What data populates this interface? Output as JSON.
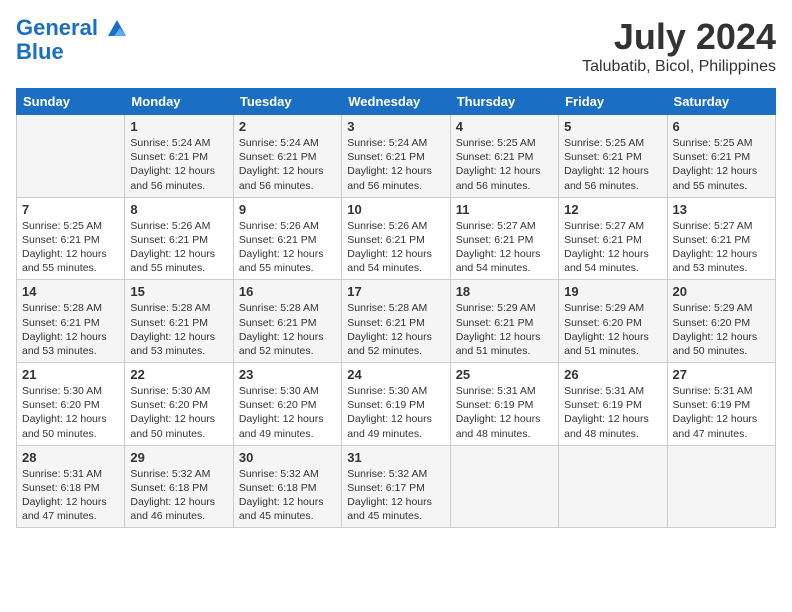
{
  "header": {
    "logo_line1": "General",
    "logo_line2": "Blue",
    "month": "July 2024",
    "location": "Talubatib, Bicol, Philippines"
  },
  "weekdays": [
    "Sunday",
    "Monday",
    "Tuesday",
    "Wednesday",
    "Thursday",
    "Friday",
    "Saturday"
  ],
  "weeks": [
    [
      {
        "day": "",
        "sunrise": "",
        "sunset": "",
        "daylight": ""
      },
      {
        "day": "1",
        "sunrise": "Sunrise: 5:24 AM",
        "sunset": "Sunset: 6:21 PM",
        "daylight": "Daylight: 12 hours and 56 minutes."
      },
      {
        "day": "2",
        "sunrise": "Sunrise: 5:24 AM",
        "sunset": "Sunset: 6:21 PM",
        "daylight": "Daylight: 12 hours and 56 minutes."
      },
      {
        "day": "3",
        "sunrise": "Sunrise: 5:24 AM",
        "sunset": "Sunset: 6:21 PM",
        "daylight": "Daylight: 12 hours and 56 minutes."
      },
      {
        "day": "4",
        "sunrise": "Sunrise: 5:25 AM",
        "sunset": "Sunset: 6:21 PM",
        "daylight": "Daylight: 12 hours and 56 minutes."
      },
      {
        "day": "5",
        "sunrise": "Sunrise: 5:25 AM",
        "sunset": "Sunset: 6:21 PM",
        "daylight": "Daylight: 12 hours and 56 minutes."
      },
      {
        "day": "6",
        "sunrise": "Sunrise: 5:25 AM",
        "sunset": "Sunset: 6:21 PM",
        "daylight": "Daylight: 12 hours and 55 minutes."
      }
    ],
    [
      {
        "day": "7",
        "sunrise": "Sunrise: 5:25 AM",
        "sunset": "Sunset: 6:21 PM",
        "daylight": "Daylight: 12 hours and 55 minutes."
      },
      {
        "day": "8",
        "sunrise": "Sunrise: 5:26 AM",
        "sunset": "Sunset: 6:21 PM",
        "daylight": "Daylight: 12 hours and 55 minutes."
      },
      {
        "day": "9",
        "sunrise": "Sunrise: 5:26 AM",
        "sunset": "Sunset: 6:21 PM",
        "daylight": "Daylight: 12 hours and 55 minutes."
      },
      {
        "day": "10",
        "sunrise": "Sunrise: 5:26 AM",
        "sunset": "Sunset: 6:21 PM",
        "daylight": "Daylight: 12 hours and 54 minutes."
      },
      {
        "day": "11",
        "sunrise": "Sunrise: 5:27 AM",
        "sunset": "Sunset: 6:21 PM",
        "daylight": "Daylight: 12 hours and 54 minutes."
      },
      {
        "day": "12",
        "sunrise": "Sunrise: 5:27 AM",
        "sunset": "Sunset: 6:21 PM",
        "daylight": "Daylight: 12 hours and 54 minutes."
      },
      {
        "day": "13",
        "sunrise": "Sunrise: 5:27 AM",
        "sunset": "Sunset: 6:21 PM",
        "daylight": "Daylight: 12 hours and 53 minutes."
      }
    ],
    [
      {
        "day": "14",
        "sunrise": "Sunrise: 5:28 AM",
        "sunset": "Sunset: 6:21 PM",
        "daylight": "Daylight: 12 hours and 53 minutes."
      },
      {
        "day": "15",
        "sunrise": "Sunrise: 5:28 AM",
        "sunset": "Sunset: 6:21 PM",
        "daylight": "Daylight: 12 hours and 53 minutes."
      },
      {
        "day": "16",
        "sunrise": "Sunrise: 5:28 AM",
        "sunset": "Sunset: 6:21 PM",
        "daylight": "Daylight: 12 hours and 52 minutes."
      },
      {
        "day": "17",
        "sunrise": "Sunrise: 5:28 AM",
        "sunset": "Sunset: 6:21 PM",
        "daylight": "Daylight: 12 hours and 52 minutes."
      },
      {
        "day": "18",
        "sunrise": "Sunrise: 5:29 AM",
        "sunset": "Sunset: 6:21 PM",
        "daylight": "Daylight: 12 hours and 51 minutes."
      },
      {
        "day": "19",
        "sunrise": "Sunrise: 5:29 AM",
        "sunset": "Sunset: 6:20 PM",
        "daylight": "Daylight: 12 hours and 51 minutes."
      },
      {
        "day": "20",
        "sunrise": "Sunrise: 5:29 AM",
        "sunset": "Sunset: 6:20 PM",
        "daylight": "Daylight: 12 hours and 50 minutes."
      }
    ],
    [
      {
        "day": "21",
        "sunrise": "Sunrise: 5:30 AM",
        "sunset": "Sunset: 6:20 PM",
        "daylight": "Daylight: 12 hours and 50 minutes."
      },
      {
        "day": "22",
        "sunrise": "Sunrise: 5:30 AM",
        "sunset": "Sunset: 6:20 PM",
        "daylight": "Daylight: 12 hours and 50 minutes."
      },
      {
        "day": "23",
        "sunrise": "Sunrise: 5:30 AM",
        "sunset": "Sunset: 6:20 PM",
        "daylight": "Daylight: 12 hours and 49 minutes."
      },
      {
        "day": "24",
        "sunrise": "Sunrise: 5:30 AM",
        "sunset": "Sunset: 6:19 PM",
        "daylight": "Daylight: 12 hours and 49 minutes."
      },
      {
        "day": "25",
        "sunrise": "Sunrise: 5:31 AM",
        "sunset": "Sunset: 6:19 PM",
        "daylight": "Daylight: 12 hours and 48 minutes."
      },
      {
        "day": "26",
        "sunrise": "Sunrise: 5:31 AM",
        "sunset": "Sunset: 6:19 PM",
        "daylight": "Daylight: 12 hours and 48 minutes."
      },
      {
        "day": "27",
        "sunrise": "Sunrise: 5:31 AM",
        "sunset": "Sunset: 6:19 PM",
        "daylight": "Daylight: 12 hours and 47 minutes."
      }
    ],
    [
      {
        "day": "28",
        "sunrise": "Sunrise: 5:31 AM",
        "sunset": "Sunset: 6:18 PM",
        "daylight": "Daylight: 12 hours and 47 minutes."
      },
      {
        "day": "29",
        "sunrise": "Sunrise: 5:32 AM",
        "sunset": "Sunset: 6:18 PM",
        "daylight": "Daylight: 12 hours and 46 minutes."
      },
      {
        "day": "30",
        "sunrise": "Sunrise: 5:32 AM",
        "sunset": "Sunset: 6:18 PM",
        "daylight": "Daylight: 12 hours and 45 minutes."
      },
      {
        "day": "31",
        "sunrise": "Sunrise: 5:32 AM",
        "sunset": "Sunset: 6:17 PM",
        "daylight": "Daylight: 12 hours and 45 minutes."
      },
      {
        "day": "",
        "sunrise": "",
        "sunset": "",
        "daylight": ""
      },
      {
        "day": "",
        "sunrise": "",
        "sunset": "",
        "daylight": ""
      },
      {
        "day": "",
        "sunrise": "",
        "sunset": "",
        "daylight": ""
      }
    ]
  ]
}
